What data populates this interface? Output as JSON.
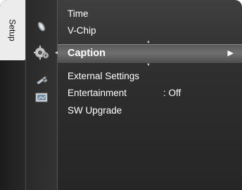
{
  "tab": {
    "label": "Setup"
  },
  "icons": [
    {
      "name": "picture-icon"
    },
    {
      "name": "setup-gear-icon"
    },
    {
      "name": "input-icon"
    },
    {
      "name": "application-icon"
    }
  ],
  "menu": {
    "items": [
      {
        "label": "Time"
      },
      {
        "label": "V-Chip"
      },
      {
        "label": "Caption",
        "selected": true
      },
      {
        "label": "External Settings"
      },
      {
        "label": "Entertainment",
        "value": ": Off"
      },
      {
        "label": "SW Upgrade"
      }
    ],
    "submenu_arrow": "▶",
    "scroll_up": "▲",
    "scroll_down": "▼",
    "pointer": "◀"
  }
}
